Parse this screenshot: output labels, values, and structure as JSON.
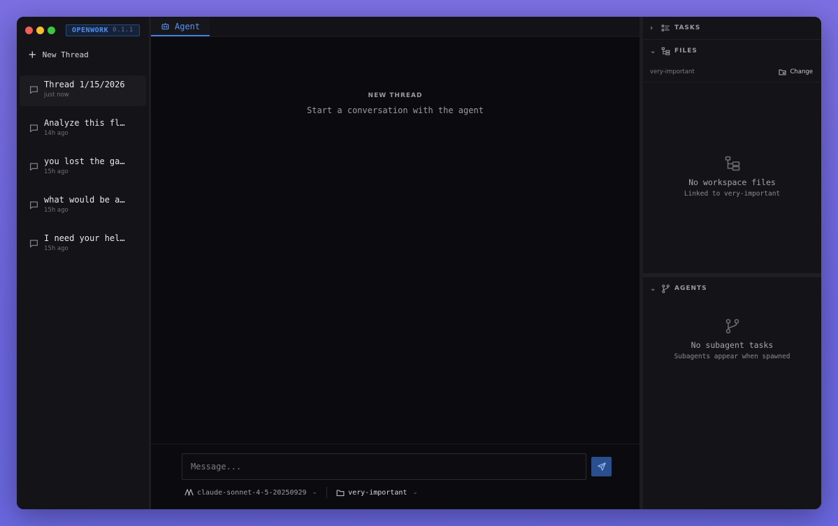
{
  "window": {
    "brand_name": "OPENWORK",
    "brand_version": "0.1.1"
  },
  "sidebar": {
    "new_thread_label": "New Thread",
    "threads": [
      {
        "title": "Thread 1/15/2026",
        "time": "just now"
      },
      {
        "title": "Analyze this fl…",
        "time": "14h ago"
      },
      {
        "title": "you lost the ga…",
        "time": "15h ago"
      },
      {
        "title": "what would be a…",
        "time": "15h ago"
      },
      {
        "title": "I need your hel…",
        "time": "15h ago"
      }
    ]
  },
  "main": {
    "tab_label": "Agent",
    "empty_heading": "NEW THREAD",
    "empty_sub": "Start a conversation with the agent",
    "message_placeholder": "Message...",
    "model_name": "claude-sonnet-4-5-20250929",
    "workspace_name": "very-important"
  },
  "right_panel": {
    "tasks_label": "TASKS",
    "files_label": "FILES",
    "workspace": "very-important",
    "change_label": "Change",
    "files_empty_title": "No workspace files",
    "files_empty_sub": "Linked to very-important",
    "agents_label": "AGENTS",
    "agents_empty_title": "No subagent tasks",
    "agents_empty_sub": "Subagents appear when spawned"
  },
  "colors": {
    "accent": "#4b8ef0",
    "background": "#0b0b0f",
    "send_button": "#2a4f8e"
  }
}
